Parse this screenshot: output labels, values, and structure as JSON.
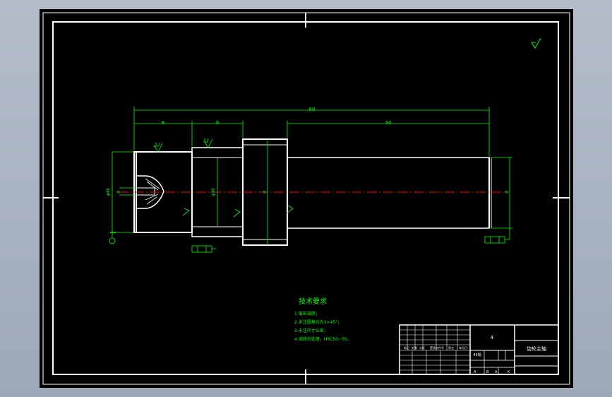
{
  "drawing": {
    "colors": {
      "background": "#000000",
      "outline": "#ffffff",
      "annotation": "#00ff00",
      "centerline": "#ff0000",
      "viewport": "#a9b4c2"
    },
    "dimensions": {
      "overall_length": "60",
      "seg1_length": "8",
      "seg2_length": "9",
      "seg3_length": "30",
      "left_diameter": "φ48",
      "seg2_diameter": "φ36",
      "collar_diameter": "φ",
      "right_diameter": "φ",
      "hole_label": "φ"
    },
    "roughness": [
      "3.2",
      "3.2"
    ],
    "tolerance_frames": [
      "",
      ""
    ],
    "technical_requirements": {
      "title": "技术要求",
      "items": [
        "1.锻前调质；",
        "2.未注圆角均为2×45°；",
        "3.未注尺寸公差；",
        "4.调质后处理，HRC50~55。"
      ]
    },
    "title_block": {
      "part_name": "齿轮主轴",
      "scale": "4",
      "material": "45钢",
      "labels": [
        "标记",
        "处数",
        "分区",
        "更改文件号",
        "签名",
        "年月日"
      ],
      "bottom_marks": [
        "A",
        "B",
        "A",
        "K"
      ]
    }
  }
}
